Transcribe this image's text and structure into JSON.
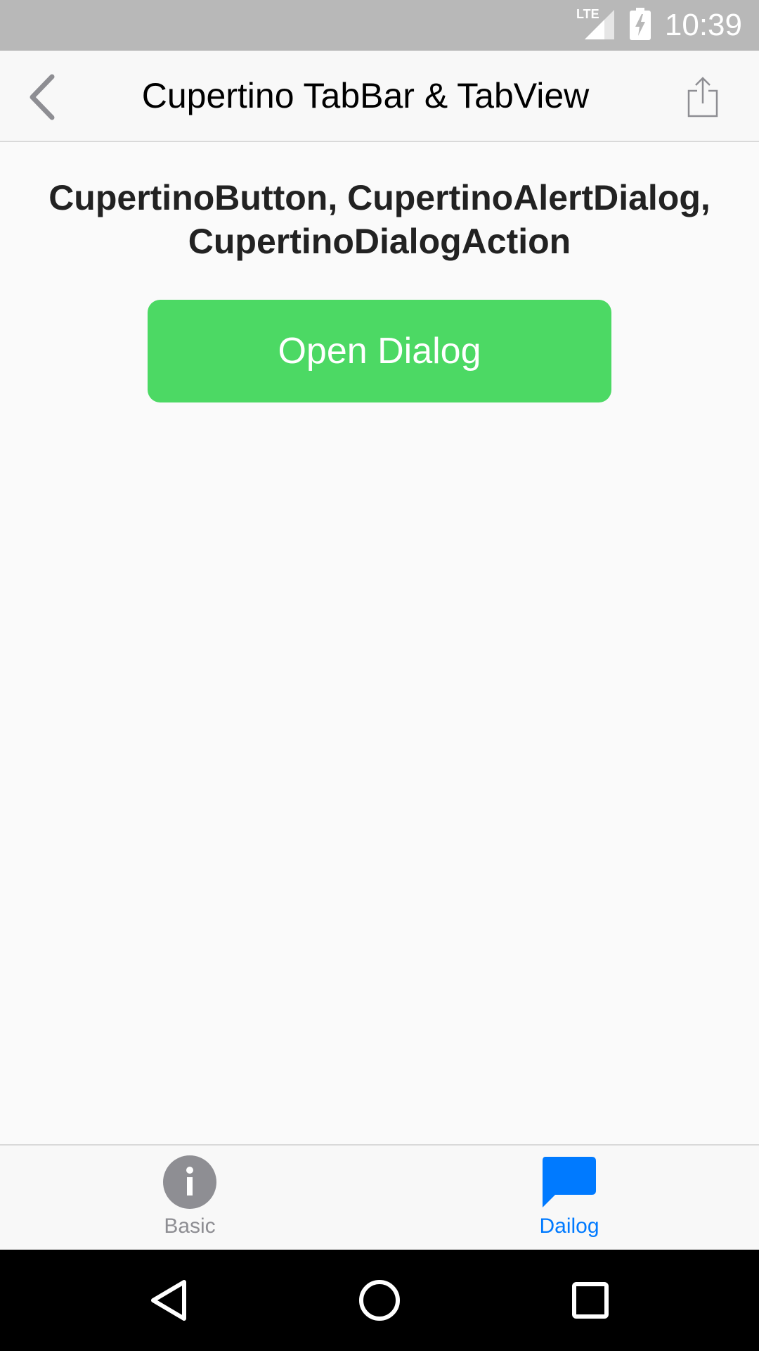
{
  "status_bar": {
    "network": "LTE",
    "time": "10:39"
  },
  "nav_bar": {
    "title": "Cupertino TabBar & TabView",
    "back_icon": "chevron-left-icon",
    "share_icon": "share-icon"
  },
  "content": {
    "heading_line1": "CupertinoButton, CupertinoAlertDialog,",
    "heading_line2": "CupertinoDialogAction",
    "open_dialog_label": "Open Dialog"
  },
  "tab_bar": {
    "tabs": [
      {
        "label": "Basic",
        "icon": "info-icon",
        "active": false
      },
      {
        "label": "Dailog",
        "icon": "chat-bubble-icon",
        "active": true
      }
    ]
  },
  "colors": {
    "status_bar": "#b8b8b8",
    "accent_green": "#4cd964",
    "active_blue": "#007aff",
    "inactive_gray": "#8e8e93"
  }
}
